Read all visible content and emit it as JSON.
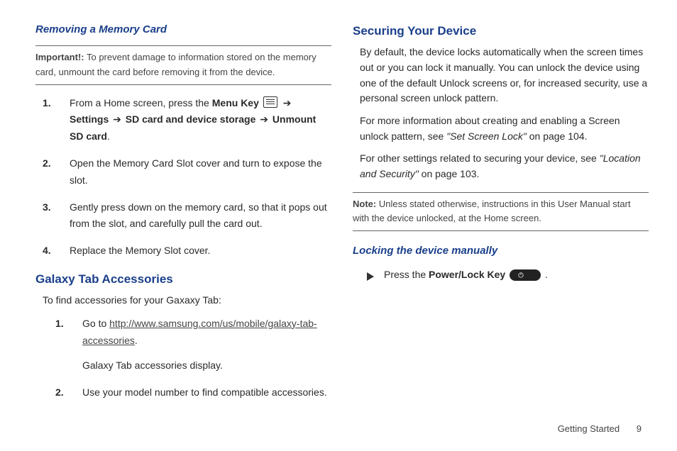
{
  "left": {
    "heading_removing": "Removing a Memory Card",
    "important_label": "Important!:",
    "important_text": " To prevent damage to information stored on the memory card, unmount the card before removing it from the device.",
    "steps_a": {
      "s1_pre": "From a Home screen, press the ",
      "s1_menu": "Menu Key",
      "s1_arrow1": " ➔ ",
      "s1_settings": "Settings",
      "s1_arrow2": " ➔ ",
      "s1_sd": "SD card and device storage",
      "s1_arrow3": " ➔ ",
      "s1_unmount": "Unmount SD card",
      "s1_post": ".",
      "s2": "Open the Memory Card Slot cover and turn to expose the slot.",
      "s3": "Gently press down on the memory card, so that it pops out from the slot, and carefully pull the card out.",
      "s4": "Replace the Memory Slot cover."
    },
    "heading_accessories": "Galaxy Tab Accessories",
    "acc_intro": "To find accessories for your Gaxaxy Tab:",
    "acc_s1_pre": "Go to ",
    "acc_s1_link": "http://www.samsung.com/us/mobile/galaxy-tab-accessories",
    "acc_s1_post": ".",
    "acc_s1_sub": "Galaxy Tab accessories display.",
    "acc_s2": "Use your model number to find compatible accessories."
  },
  "right": {
    "heading_securing": "Securing Your Device",
    "sec_p1": "By default, the device locks automatically when the screen times out or you can lock it manually. You can unlock the device using one of the default Unlock screens or, for increased security, use a personal screen unlock pattern.",
    "sec_p2_pre": "For more information about creating and enabling a Screen unlock pattern, see ",
    "sec_p2_ital": "\"Set Screen Lock\"",
    "sec_p2_post": " on page 104.",
    "sec_p3_pre": "For other settings related to securing your device, see ",
    "sec_p3_ital": "\"Location and Security\"",
    "sec_p3_post": " on page 103.",
    "note_label": "Note:",
    "note_text": " Unless stated otherwise, instructions in this User Manual start with the device unlocked, at the Home screen.",
    "heading_locking": "Locking the device manually",
    "lock_pre": "Press the ",
    "lock_key": "Power/Lock Key",
    "lock_post": " ."
  },
  "footer": {
    "section": "Getting Started",
    "page": "9"
  }
}
